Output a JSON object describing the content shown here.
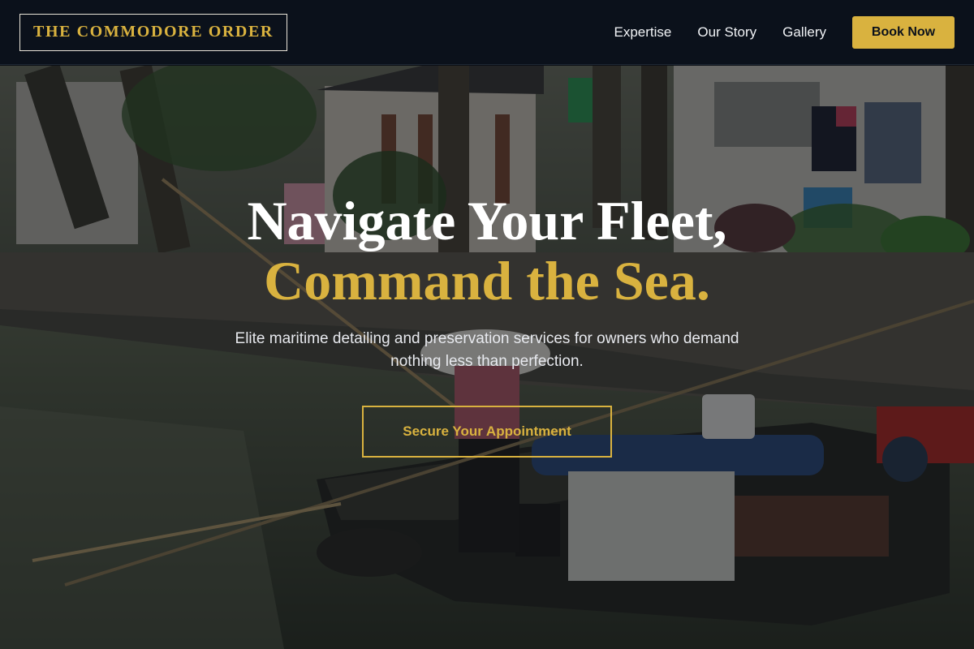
{
  "nav": {
    "logo": "THE COMMODORE ORDER",
    "links": [
      "Expertise",
      "Our Story",
      "Gallery"
    ],
    "book_button": "Book Now"
  },
  "hero": {
    "headline_line1": "Navigate Your Fleet,",
    "headline_line2": "Command the Sea.",
    "subtitle": "Elite maritime detailing and preservation services for owners who demand nothing less than perfection.",
    "cta": "Secure Your Appointment"
  },
  "colors": {
    "accent_gold": "#d9b23f",
    "navbar_bg": "#0b111b",
    "text_white": "#ffffff"
  }
}
